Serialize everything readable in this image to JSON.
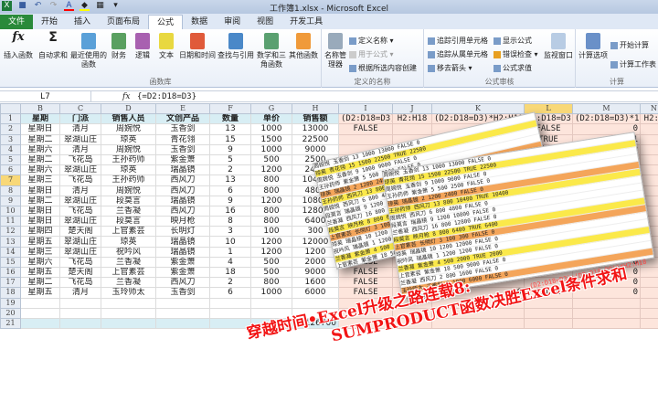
{
  "window": {
    "title": "工作簿1.xlsx - Microsoft Excel"
  },
  "tabs": [
    "文件",
    "开始",
    "插入",
    "页面布局",
    "公式",
    "数据",
    "审阅",
    "视图",
    "开发工具"
  ],
  "active_tab": "公式",
  "ribbon": {
    "function_library": {
      "label": "函数库",
      "buttons": [
        "插入函数",
        "自动求和",
        "最近使用的函数",
        "财务",
        "逻辑",
        "文本",
        "日期和时间",
        "查找与引用",
        "数学和三角函数",
        "其他函数"
      ]
    },
    "defined_names": {
      "label": "定义的名称",
      "manager": "名称管理器",
      "items": [
        "定义名称",
        "用于公式",
        "根据所选内容创建"
      ]
    },
    "formula_auditing": {
      "label": "公式审核",
      "items": [
        "追踪引用单元格",
        "追踪从属单元格",
        "移去箭头",
        "显示公式",
        "错误检查",
        "公式求值"
      ],
      "watch": "监视窗口"
    },
    "calculation": {
      "label": "计算",
      "options": "计算选项",
      "items": [
        "开始计算",
        "计算工作表"
      ]
    }
  },
  "formula_bar": {
    "name_box": "L7",
    "fx": "fx",
    "formula": "{=D2:D18=D3}"
  },
  "columns": [
    "B",
    "C",
    "D",
    "E",
    "F",
    "G",
    "H",
    "I",
    "J",
    "K",
    "L",
    "M",
    "N"
  ],
  "selected_column": "L",
  "header_row": [
    "星期",
    "门派",
    "销售人员",
    "文创产品",
    "数量",
    "单价",
    "销售额",
    "(D2:D18=D3)",
    "H2:H18",
    "(D2:D18=D3)*H2:H18",
    "D2:D18=D3",
    "(D2:D18=D3)*1",
    "H2:H"
  ],
  "rows": [
    [
      "星期日",
      "清月",
      "周婉悦",
      "玉香剑",
      "13",
      "1000",
      "13000",
      "FALSE",
      "",
      "0",
      "FALSE",
      "0"
    ],
    [
      "星期二",
      "翠湖山庄",
      "琼英",
      "青花翎",
      "15",
      "1500",
      "22500",
      "",
      "",
      "0",
      "TRUE",
      "1"
    ],
    [
      "星期六",
      "清月",
      "周婉悦",
      "玉香剑",
      "9",
      "1000",
      "9000",
      "",
      "",
      "0",
      "FALSE",
      "0"
    ],
    [
      "星期二",
      "飞花岛",
      "王孙药师",
      "紫金箫",
      "5",
      "500",
      "2500",
      "",
      "",
      "0",
      "",
      "0"
    ],
    [
      "星期六",
      "翠湖山庄",
      "琼英",
      "瑞晶镜",
      "2",
      "1200",
      "2400",
      "",
      "",
      "",
      "",
      ""
    ],
    [
      "星期三",
      "飞花岛",
      "王孙药师",
      "西风刀",
      "13",
      "800",
      "10400",
      "",
      "",
      "",
      "",
      ""
    ],
    [
      "星期日",
      "清月",
      "周婉悦",
      "西风刀",
      "6",
      "800",
      "4800",
      "",
      "",
      "",
      "",
      ""
    ],
    [
      "星期二",
      "翠湖山庄",
      "段莫言",
      "瑞晶镜",
      "9",
      "1200",
      "10800",
      "",
      "",
      "",
      "",
      ""
    ],
    [
      "星期日",
      "飞花岛",
      "兰香凝",
      "西风刀",
      "16",
      "800",
      "12800",
      "",
      "",
      "",
      "",
      ""
    ],
    [
      "星期日",
      "翠湖山庄",
      "段莫言",
      "映月枪",
      "8",
      "800",
      "6400",
      "",
      "",
      "",
      "",
      ""
    ],
    [
      "星期四",
      "楚天阁",
      "上官素芸",
      "长明灯",
      "3",
      "100",
      "300",
      "",
      "",
      "",
      "",
      ""
    ],
    [
      "星期五",
      "翠湖山庄",
      "琼英",
      "瑞晶镜",
      "10",
      "1200",
      "12000",
      "TRUE",
      "",
      "",
      "",
      ""
    ],
    [
      "星期三",
      "翠湖山庄",
      "祝吟风",
      "瑞晶镜",
      "1",
      "1200",
      "1200",
      "FALSE",
      "",
      "",
      "",
      ""
    ],
    [
      "星期六",
      "飞花岛",
      "兰香凝",
      "紫金箫",
      "4",
      "500",
      "2000",
      "FALSE",
      "",
      "",
      "",
      "0"
    ],
    [
      "星期五",
      "楚天阁",
      "上官素芸",
      "紫金箫",
      "18",
      "500",
      "9000",
      "FALSE",
      "",
      "",
      "",
      "0"
    ],
    [
      "星期二",
      "飞花岛",
      "兰香凝",
      "西风刀",
      "2",
      "800",
      "1600",
      "FALSE",
      "",
      "",
      "",
      "0"
    ],
    [
      "星期五",
      "清月",
      "玉玲师太",
      "玉香剑",
      "6",
      "1000",
      "6000",
      "FALSE",
      "",
      "0",
      "FALSE",
      "0"
    ]
  ],
  "total": "126700",
  "overlay": {
    "formula_caption": "(D2:D18=D3)+(D2:D18=D9))*H2:H18",
    "banner_line1": "穿越时间•Excel升级之路连载8:",
    "banner_line2": "SUMPRODUCT函数决胜Excel条件求和",
    "highlight_colors": {
      "yellow": "#fbe94a",
      "orange": "#f4a55a"
    }
  }
}
